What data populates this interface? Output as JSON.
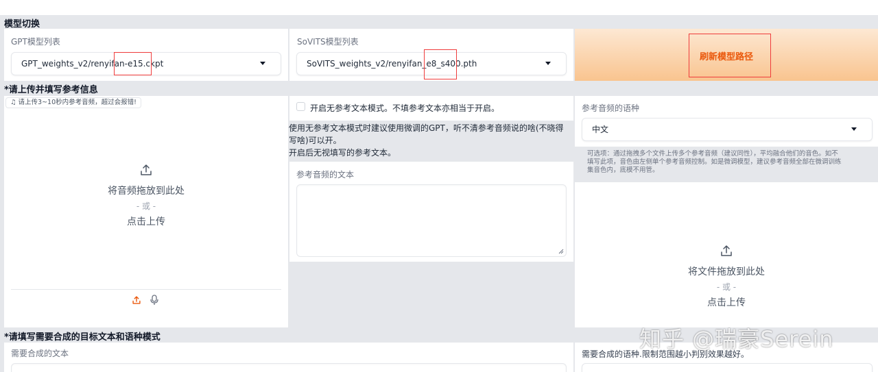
{
  "model_switch": {
    "title": "模型切换",
    "gpt_label": "GPT模型列表",
    "gpt_value": "GPT_weights_v2/renyifan-e15.ckpt",
    "sovits_label": "SoVITS模型列表",
    "sovits_value": "SoVITS_weights_v2/renyifan_e8_s400.pth",
    "refresh_label": "刷新模型路径"
  },
  "reference": {
    "title": "*请上传并填写参考信息",
    "audio_upload_label": "请上传3~10秒内参考音频，超过会报错!",
    "drop_text": "将音频拖放到此处",
    "or_text": "- 或 -",
    "click_text": "点击上传",
    "no_ref_checkbox_label": "开启无参考文本模式。不填参考文本亦相当于开启。",
    "no_ref_note_line1": "使用无参考文本模式时建议使用微调的GPT，听不清参考音频说的啥(不晓得",
    "no_ref_note_line2": "写啥)可以开。",
    "no_ref_note_line3": "开启后无视填写的参考文本。",
    "ref_text_label": "参考音频的文本",
    "ref_lang_label": "参考音频的语种",
    "ref_lang_value": "中文",
    "multi_ref_hint_line1": "可选项：通过拖拽多个文件上传多个参考音频（建议同性），平均融合他们的音色。如不",
    "multi_ref_hint_line2": "填写此项，音色由左侧单个参考音频控制。如是微调模型，建议参考音频全部在微调训练",
    "multi_ref_hint_line3": "集音色内，底模不用管。",
    "file_drop_text": "将文件拖放到此处",
    "file_or_text": "- 或 -",
    "file_click_text": "点击上传"
  },
  "target": {
    "title": "*请填写需要合成的目标文本和语种模式",
    "text_label": "需要合成的文本",
    "lang_label": "需要合成的语种.限制范围越小判别效果越好。"
  },
  "watermark": "知乎 @瑞豪Serein",
  "colors": {
    "band": "#e5e7eb",
    "accent": "#ea580c",
    "highlight_box": "#ef3b3b"
  }
}
